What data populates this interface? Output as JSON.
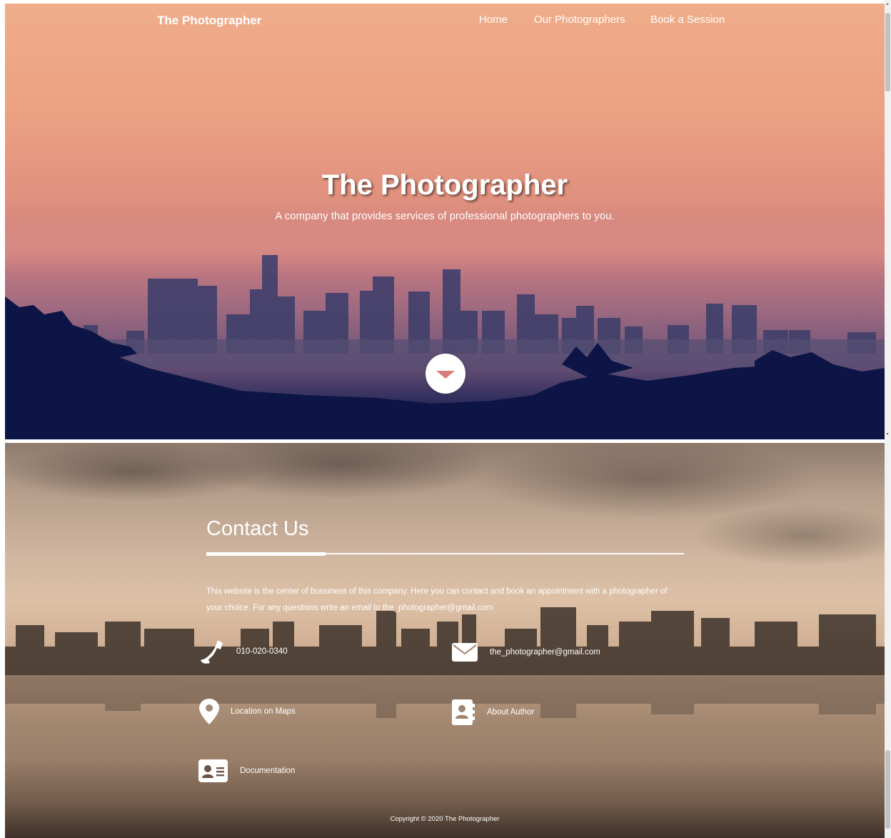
{
  "navbar": {
    "brand": "The Photographer",
    "links": [
      {
        "label": "Home"
      },
      {
        "label": "Our Photographers"
      },
      {
        "label": "Book a Session"
      }
    ]
  },
  "hero": {
    "title": "The Photographer",
    "subtitle": "A company that provides services of professional photographers to you.",
    "scroll_icon": "chevron-down-icon"
  },
  "contact": {
    "title": "Contact Us",
    "description": "This website is the center of bussiness of this company. Here you can contact and book an appointment with a photographer of your choice. For any questions write an email to the_photographer@gmail.com",
    "items": [
      {
        "icon": "phone-icon",
        "label": "010-020-0340"
      },
      {
        "icon": "envelope-icon",
        "label": "the_photographer@gmail.com"
      },
      {
        "icon": "map-pin-icon",
        "label": "Location on Maps"
      },
      {
        "icon": "address-book-icon",
        "label": "About Author"
      },
      {
        "icon": "id-card-icon",
        "label": "Documentation"
      }
    ]
  },
  "footer": {
    "copyright": "Copyright © 2020 The Photographer"
  },
  "colors": {
    "hero_top": "#efad8a",
    "hero_bottom": "#0d1546",
    "scroll_arrow": "#d77e7a",
    "contact_mid": "#ddc0a6"
  }
}
